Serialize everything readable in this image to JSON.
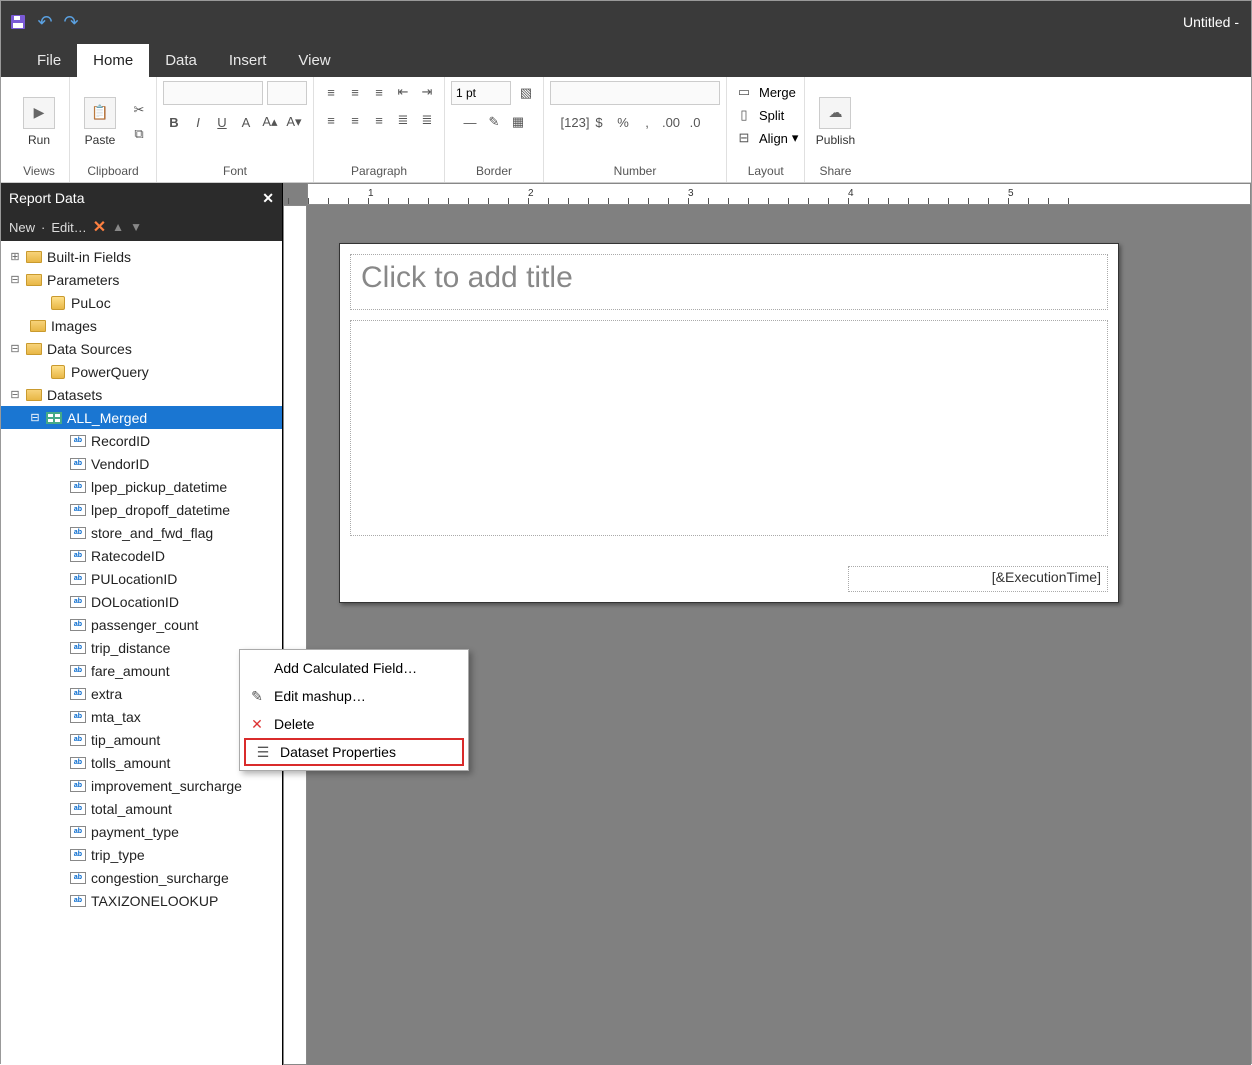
{
  "title": "Untitled -",
  "tabs": [
    "File",
    "Home",
    "Data",
    "Insert",
    "View"
  ],
  "activeTab": "Home",
  "ribbonGroups": {
    "views": "Views",
    "clipboard": "Clipboard",
    "font": "Font",
    "paragraph": "Paragraph",
    "border": "Border",
    "number": "Number",
    "layout": "Layout",
    "share": "Share"
  },
  "ribbonButtons": {
    "run": "Run",
    "paste": "Paste",
    "publish": "Publish",
    "merge": "Merge",
    "split": "Split",
    "align": "Align"
  },
  "borderPt": "1 pt",
  "panelHeader": "Report Data",
  "panelTools": {
    "new": "New",
    "edit": "Edit…"
  },
  "tree": {
    "builtin": "Built-in Fields",
    "parameters": "Parameters",
    "puloc": "PuLoc",
    "images": "Images",
    "datasources": "Data Sources",
    "powerquery": "PowerQuery",
    "datasets": "Datasets",
    "allmerged": "ALL_Merged",
    "fields": [
      "RecordID",
      "VendorID",
      "lpep_pickup_datetime",
      "lpep_dropoff_datetime",
      "store_and_fwd_flag",
      "RatecodeID",
      "PULocationID",
      "DOLocationID",
      "passenger_count",
      "trip_distance",
      "fare_amount",
      "extra",
      "mta_tax",
      "tip_amount",
      "tolls_amount",
      "improvement_surcharge",
      "total_amount",
      "payment_type",
      "trip_type",
      "congestion_surcharge",
      "TAXIZONELOOKUP"
    ]
  },
  "contextMenu": [
    "Add Calculated Field…",
    "Edit mashup…",
    "Delete",
    "Dataset Properties"
  ],
  "highlightedContext": "Dataset Properties",
  "canvas": {
    "titlePlaceholder": "Click to add title",
    "footer": "[&ExecutionTime]"
  },
  "rulerMarks": [
    "1",
    "2",
    "3",
    "4",
    "5"
  ]
}
